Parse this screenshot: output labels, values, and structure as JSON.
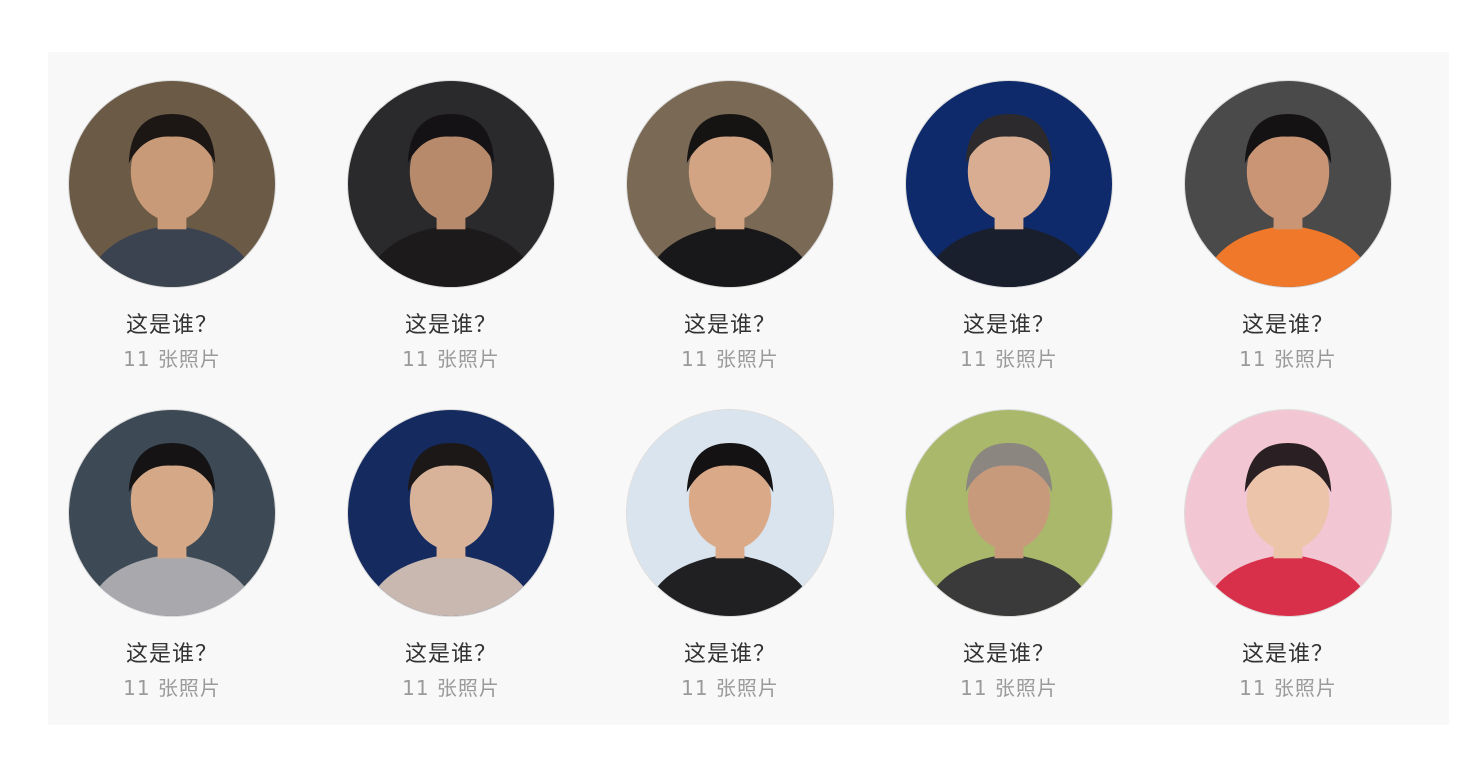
{
  "people": [
    {
      "name": "这是谁？",
      "photo_count": "11 张照片",
      "bg": "#6b5a45",
      "shirt": "#3b4350",
      "skin": "#c99a78",
      "hair": "#1c1714"
    },
    {
      "name": "这是谁？",
      "photo_count": "11 张照片",
      "bg": "#2a2a2c",
      "shirt": "#1d1a1c",
      "skin": "#b78a6c",
      "hair": "#141214"
    },
    {
      "name": "这是谁？",
      "photo_count": "11 张照片",
      "bg": "#7a6a55",
      "shirt": "#18181a",
      "skin": "#d2a484",
      "hair": "#161413"
    },
    {
      "name": "这是谁？",
      "photo_count": "11 张照片",
      "bg": "#0e2a6a",
      "shirt": "#1a1f2e",
      "skin": "#d8ad92",
      "hair": "#2c2a2c"
    },
    {
      "name": "这是谁？",
      "photo_count": "11 张照片",
      "bg": "#4a4a4a",
      "shirt": "#f0782a",
      "skin": "#c99575",
      "hair": "#141213"
    },
    {
      "name": "这是谁？",
      "photo_count": "11 张照片",
      "bg": "#3d4a55",
      "shirt": "#a9a9ad",
      "skin": "#d5a888",
      "hair": "#151314"
    },
    {
      "name": "这是谁？",
      "photo_count": "11 张照片",
      "bg": "#152a5e",
      "shirt": "#c8b8b0",
      "skin": "#d8b39a",
      "hair": "#1b1817"
    },
    {
      "name": "这是谁？",
      "photo_count": "11 张照片",
      "bg": "#d9e4ee",
      "shirt": "#202022",
      "skin": "#d9a988",
      "hair": "#141213"
    },
    {
      "name": "这是谁？",
      "photo_count": "11 张照片",
      "bg": "#a9b86a",
      "shirt": "#3b3a3a",
      "skin": "#c89a7c",
      "hair": "#8b8680"
    },
    {
      "name": "这是谁？",
      "photo_count": "11 张照片",
      "bg": "#f2c6d2",
      "shirt": "#d8304a",
      "skin": "#ecc4aa",
      "hair": "#2a1f22"
    }
  ]
}
